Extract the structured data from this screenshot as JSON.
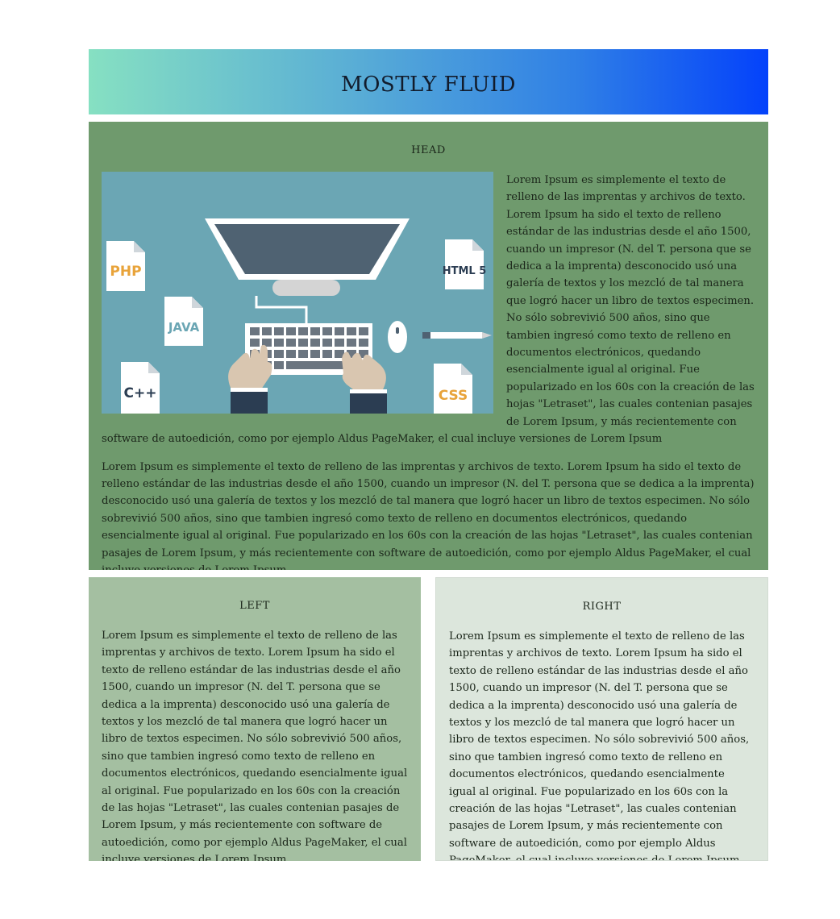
{
  "page": {
    "title": "MOSTLY FLUID"
  },
  "head": {
    "title": "HEAD",
    "image": {
      "name": "computer-keyboard-illustration",
      "labels": {
        "php": "PHP",
        "java": "JAVA",
        "cpp": "C++",
        "html5": "HTML 5",
        "css": "CSS"
      }
    },
    "paragraph1": "Lorem Ipsum es simplemente el texto de relleno de las imprentas y archivos de texto. Lorem Ipsum ha sido el texto de relleno estándar de las industrias desde el año 1500, cuando un impresor (N. del T. persona que se dedica a la imprenta) desconocido usó una galería de textos y los mezcló de tal manera que logró hacer un libro de textos especimen. No sólo sobrevivió 500 años, sino que tambien ingresó como texto de relleno en documentos electrónicos, quedando esencialmente igual al original. Fue popularizado en los 60s con la creación de las hojas \"Letraset\", las cuales contenian pasajes de Lorem Ipsum, y más recientemente con software de autoedición, como por ejemplo Aldus PageMaker, el cual incluye versiones de Lorem Ipsum",
    "paragraph2": "Lorem Ipsum es simplemente el texto de relleno de las imprentas y archivos de texto. Lorem Ipsum ha sido el texto de relleno estándar de las industrias desde el año 1500, cuando un impresor (N. del T. persona que se dedica a la imprenta) desconocido usó una galería de textos y los mezcló de tal manera que logró hacer un libro de textos especimen. No sólo sobrevivió 500 años, sino que tambien ingresó como texto de relleno en documentos electrónicos, quedando esencialmente igual al original. Fue popularizado en los 60s con la creación de las hojas \"Letraset\", las cuales contenian pasajes de Lorem Ipsum, y más recientemente con software de autoedición, como por ejemplo Aldus PageMaker, el cual incluye versiones de Lorem Ipsum"
  },
  "left": {
    "title": "LEFT",
    "paragraph": "Lorem Ipsum es simplemente el texto de relleno de las imprentas y archivos de texto. Lorem Ipsum ha sido el texto de relleno estándar de las industrias desde el año 1500, cuando un impresor (N. del T. persona que se dedica a la imprenta) desconocido usó una galería de textos y los mezcló de tal manera que logró hacer un libro de textos especimen. No sólo sobrevivió 500 años, sino que tambien ingresó como texto de relleno en documentos electrónicos, quedando esencialmente igual al original. Fue popularizado en los 60s con la creación de las hojas \"Letraset\", las cuales contenian pasajes de Lorem Ipsum, y más recientemente con software de autoedición, como por ejemplo Aldus PageMaker, el cual incluye versiones de Lorem Ipsum"
  },
  "right": {
    "title": "RIGHT",
    "paragraph": "Lorem Ipsum es simplemente el texto de relleno de las imprentas y archivos de texto. Lorem Ipsum ha sido el texto de relleno estándar de las industrias desde el año 1500, cuando un impresor (N. del T. persona que se dedica a la imprenta) desconocido usó una galería de textos y los mezcló de tal manera que logró hacer un libro de textos especimen. No sólo sobrevivió 500 años, sino que tambien ingresó como texto de relleno en documentos electrónicos, quedando esencialmente igual al original. Fue popularizado en los 60s con la creación de las hojas \"Letraset\", las cuales contenian pasajes de Lorem Ipsum, y más recientemente con software de autoedición, como por ejemplo Aldus PageMaker, el cual incluye versiones de Lorem Ipsum"
  },
  "colors": {
    "banner_start": "#86e0c2",
    "banner_end": "#0442fb",
    "head_bg": "#6f9a6d",
    "left_bg": "#a4bfa1",
    "right_bg": "#dce6dc",
    "image_bg": "#6ba6b4"
  }
}
